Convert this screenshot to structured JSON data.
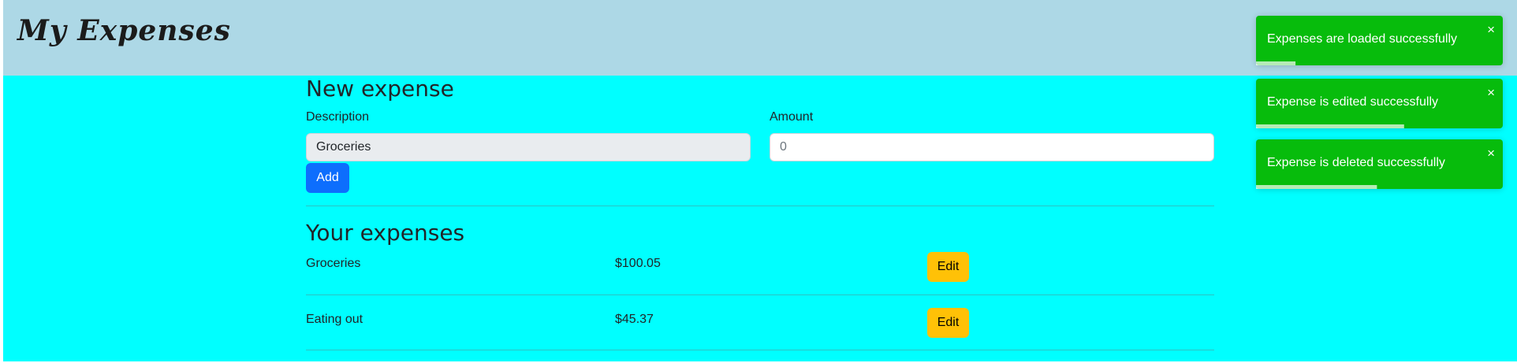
{
  "header": {
    "brand": "My Expenses"
  },
  "form": {
    "title": "New expense",
    "description_label": "Description",
    "description_value": "Groceries",
    "amount_label": "Amount",
    "amount_value": "0",
    "add_label": "Add"
  },
  "list": {
    "title": "Your expenses",
    "edit_label": "Edit",
    "items": [
      {
        "description": "Groceries",
        "amount": "$100.05"
      },
      {
        "description": "Eating out",
        "amount": "$45.37"
      }
    ]
  },
  "toasts": [
    {
      "message": "Expenses are loaded successfully",
      "close": "×",
      "progress": 0.16
    },
    {
      "message": "Expense is edited successfully",
      "close": "×",
      "progress": 0.6
    },
    {
      "message": "Expense is deleted successfully",
      "close": "×",
      "progress": 0.49
    }
  ],
  "colors": {
    "header": "#add8e6",
    "content": "#00ffff",
    "add_button": "#0d6efd",
    "edit_button": "#ffc107",
    "toast_success": "#07bc0c"
  }
}
